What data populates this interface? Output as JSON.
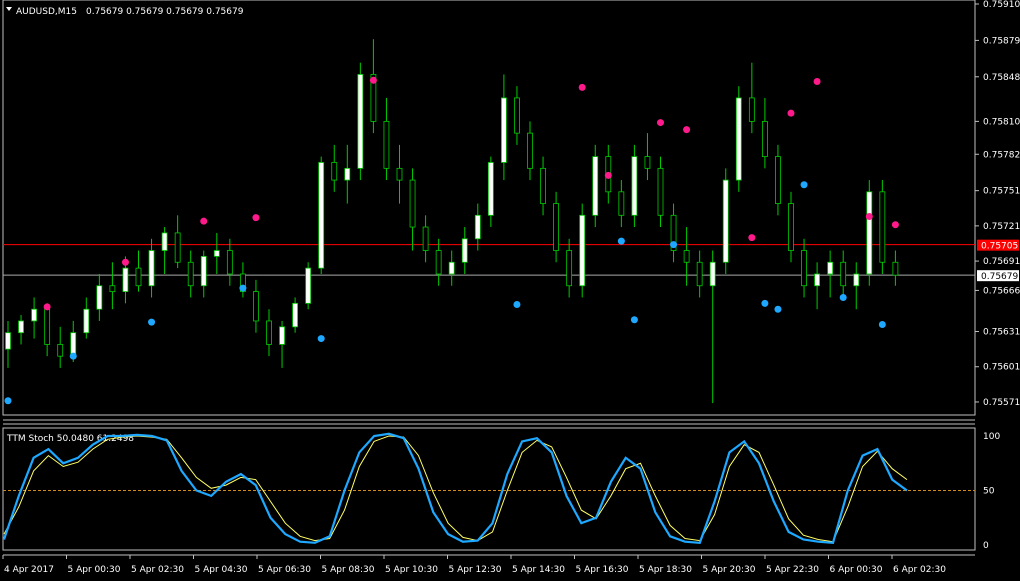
{
  "main_chart": {
    "title": "AUDUSD,M15",
    "ohlc": "0.75679 0.75679 0.75679 0.75679",
    "y_range": [
      0.75565,
      0.7591
    ],
    "price_labels": [
      "0.75910",
      "0.75879",
      "0.75848",
      "0.75810",
      "0.75782",
      "0.75751",
      "0.75721",
      "0.75691",
      "0.75666",
      "0.75631",
      "0.75601",
      "0.75571"
    ],
    "red_line": {
      "label": "0.75705",
      "value": 0.75705
    },
    "grey_line": {
      "label": "0.75679",
      "value": 0.75679
    },
    "colors": {
      "bull_fill": "#ffffff",
      "bear_fill": "#000000",
      "wick": "#00cc00",
      "red_line": "#ff0000",
      "grey_line": "#aaaaaa",
      "dot_pink": "#ff1a8c",
      "dot_blue": "#1ea8ff"
    },
    "candles": [
      [
        0.75616,
        0.7564,
        0.756,
        0.7563
      ],
      [
        0.7563,
        0.75645,
        0.7562,
        0.7564
      ],
      [
        0.7564,
        0.7566,
        0.75625,
        0.7565
      ],
      [
        0.7565,
        0.75655,
        0.7561,
        0.7562
      ],
      [
        0.7562,
        0.75635,
        0.756,
        0.7561
      ],
      [
        0.7561,
        0.7564,
        0.75605,
        0.7563
      ],
      [
        0.7563,
        0.7566,
        0.75625,
        0.7565
      ],
      [
        0.7565,
        0.7568,
        0.7564,
        0.7567
      ],
      [
        0.7567,
        0.7569,
        0.7565,
        0.75665
      ],
      [
        0.75665,
        0.75695,
        0.75655,
        0.75685
      ],
      [
        0.75685,
        0.757,
        0.75665,
        0.7567
      ],
      [
        0.7567,
        0.7571,
        0.7566,
        0.757
      ],
      [
        0.757,
        0.7572,
        0.7568,
        0.75715
      ],
      [
        0.75715,
        0.7573,
        0.75685,
        0.7569
      ],
      [
        0.7569,
        0.757,
        0.7566,
        0.7567
      ],
      [
        0.7567,
        0.757,
        0.7566,
        0.75695
      ],
      [
        0.75695,
        0.75715,
        0.7568,
        0.757
      ],
      [
        0.757,
        0.7571,
        0.7567,
        0.7568
      ],
      [
        0.7568,
        0.7569,
        0.7566,
        0.75665
      ],
      [
        0.75665,
        0.75675,
        0.7563,
        0.7564
      ],
      [
        0.7564,
        0.7565,
        0.7561,
        0.7562
      ],
      [
        0.7562,
        0.7564,
        0.756,
        0.75635
      ],
      [
        0.75635,
        0.7566,
        0.7563,
        0.75655
      ],
      [
        0.75655,
        0.7569,
        0.7565,
        0.75685
      ],
      [
        0.75685,
        0.7578,
        0.7568,
        0.75775
      ],
      [
        0.75775,
        0.7579,
        0.7575,
        0.7576
      ],
      [
        0.7576,
        0.7579,
        0.7574,
        0.7577
      ],
      [
        0.7577,
        0.7586,
        0.7576,
        0.7585
      ],
      [
        0.7585,
        0.7588,
        0.758,
        0.7581
      ],
      [
        0.7581,
        0.7583,
        0.7576,
        0.7577
      ],
      [
        0.7577,
        0.7579,
        0.7574,
        0.7576
      ],
      [
        0.7576,
        0.7577,
        0.757,
        0.7572
      ],
      [
        0.7572,
        0.7573,
        0.7569,
        0.757
      ],
      [
        0.757,
        0.7571,
        0.7567,
        0.7568
      ],
      [
        0.7568,
        0.757,
        0.7567,
        0.7569
      ],
      [
        0.7569,
        0.7572,
        0.7568,
        0.7571
      ],
      [
        0.7571,
        0.7574,
        0.757,
        0.7573
      ],
      [
        0.7573,
        0.7578,
        0.7572,
        0.75775
      ],
      [
        0.75775,
        0.7585,
        0.7576,
        0.7583
      ],
      [
        0.7583,
        0.7584,
        0.7579,
        0.758
      ],
      [
        0.758,
        0.7581,
        0.7576,
        0.7577
      ],
      [
        0.7577,
        0.7578,
        0.7573,
        0.7574
      ],
      [
        0.7574,
        0.7575,
        0.7569,
        0.757
      ],
      [
        0.757,
        0.7571,
        0.7566,
        0.7567
      ],
      [
        0.7567,
        0.7574,
        0.7566,
        0.7573
      ],
      [
        0.7573,
        0.7579,
        0.7572,
        0.7578
      ],
      [
        0.7578,
        0.7579,
        0.7574,
        0.7575
      ],
      [
        0.7575,
        0.7576,
        0.7572,
        0.7573
      ],
      [
        0.7573,
        0.7579,
        0.7572,
        0.7578
      ],
      [
        0.7578,
        0.758,
        0.7576,
        0.7577
      ],
      [
        0.7577,
        0.7578,
        0.7572,
        0.7573
      ],
      [
        0.7573,
        0.7574,
        0.7569,
        0.757
      ],
      [
        0.757,
        0.7572,
        0.7567,
        0.7569
      ],
      [
        0.7569,
        0.757,
        0.7566,
        0.7567
      ],
      [
        0.7567,
        0.757,
        0.7557,
        0.7569
      ],
      [
        0.7569,
        0.7577,
        0.7568,
        0.7576
      ],
      [
        0.7576,
        0.7584,
        0.7575,
        0.7583
      ],
      [
        0.7583,
        0.7586,
        0.758,
        0.7581
      ],
      [
        0.7581,
        0.7583,
        0.7577,
        0.7578
      ],
      [
        0.7578,
        0.7579,
        0.7573,
        0.7574
      ],
      [
        0.7574,
        0.7575,
        0.7569,
        0.757
      ],
      [
        0.757,
        0.7571,
        0.7566,
        0.7567
      ],
      [
        0.7567,
        0.7569,
        0.7565,
        0.7568
      ],
      [
        0.7568,
        0.757,
        0.7566,
        0.7569
      ],
      [
        0.7569,
        0.757,
        0.7566,
        0.7567
      ],
      [
        0.7567,
        0.7569,
        0.7565,
        0.7568
      ],
      [
        0.7568,
        0.7576,
        0.7567,
        0.7575
      ],
      [
        0.7575,
        0.7576,
        0.7568,
        0.7569
      ],
      [
        0.7569,
        0.757,
        0.7567,
        0.75679
      ]
    ],
    "dots": [
      {
        "i": 0,
        "v": 0.75572,
        "c": "blue"
      },
      {
        "i": 3,
        "v": 0.75652,
        "c": "pink"
      },
      {
        "i": 5,
        "v": 0.7561,
        "c": "blue"
      },
      {
        "i": 9,
        "v": 0.7569,
        "c": "pink"
      },
      {
        "i": 11,
        "v": 0.75639,
        "c": "blue"
      },
      {
        "i": 15,
        "v": 0.75725,
        "c": "pink"
      },
      {
        "i": 18,
        "v": 0.75668,
        "c": "blue"
      },
      {
        "i": 19,
        "v": 0.75728,
        "c": "pink"
      },
      {
        "i": 24,
        "v": 0.75625,
        "c": "blue"
      },
      {
        "i": 28,
        "v": 0.75845,
        "c": "pink"
      },
      {
        "i": 39,
        "v": 0.75654,
        "c": "blue"
      },
      {
        "i": 44,
        "v": 0.75839,
        "c": "pink"
      },
      {
        "i": 46,
        "v": 0.75764,
        "c": "pink"
      },
      {
        "i": 47,
        "v": 0.75708,
        "c": "blue"
      },
      {
        "i": 48,
        "v": 0.75641,
        "c": "blue"
      },
      {
        "i": 50,
        "v": 0.75809,
        "c": "pink"
      },
      {
        "i": 51,
        "v": 0.75705,
        "c": "blue"
      },
      {
        "i": 52,
        "v": 0.75803,
        "c": "pink"
      },
      {
        "i": 57,
        "v": 0.75711,
        "c": "pink"
      },
      {
        "i": 58,
        "v": 0.75655,
        "c": "blue"
      },
      {
        "i": 59,
        "v": 0.7565,
        "c": "blue"
      },
      {
        "i": 60,
        "v": 0.75817,
        "c": "pink"
      },
      {
        "i": 61,
        "v": 0.75756,
        "c": "blue"
      },
      {
        "i": 62,
        "v": 0.75844,
        "c": "pink"
      },
      {
        "i": 64,
        "v": 0.7566,
        "c": "blue"
      },
      {
        "i": 66,
        "v": 0.75729,
        "c": "pink"
      },
      {
        "i": 67,
        "v": 0.75637,
        "c": "blue"
      },
      {
        "i": 68,
        "v": 0.75722,
        "c": "pink"
      }
    ]
  },
  "stoch_panel": {
    "title": "TTM Stoch 50.0480 61.2498",
    "levels": [
      "100",
      "50",
      "0"
    ],
    "level_line": 50,
    "colors": {
      "fast": "#1ea8ff",
      "slow": "#ffff66",
      "level": "#d08a1a"
    },
    "fast": [
      5,
      45,
      80,
      88,
      75,
      80,
      92,
      100,
      100,
      101,
      100,
      96,
      68,
      50,
      45,
      58,
      65,
      55,
      25,
      10,
      3,
      2,
      8,
      50,
      85,
      100,
      102,
      98,
      70,
      30,
      10,
      3,
      4,
      20,
      65,
      95,
      98,
      85,
      45,
      20,
      25,
      58,
      80,
      70,
      30,
      8,
      3,
      2,
      40,
      85,
      95,
      75,
      40,
      12,
      5,
      3,
      2,
      50,
      82,
      88,
      60,
      50
    ],
    "slow": [
      10,
      35,
      68,
      82,
      72,
      76,
      88,
      97,
      99,
      100,
      99,
      97,
      80,
      62,
      52,
      55,
      62,
      60,
      40,
      20,
      8,
      4,
      6,
      32,
      72,
      95,
      100,
      99,
      82,
      48,
      20,
      7,
      4,
      12,
      50,
      85,
      96,
      90,
      62,
      32,
      24,
      45,
      70,
      75,
      45,
      18,
      6,
      4,
      28,
      72,
      92,
      85,
      55,
      24,
      9,
      5,
      3,
      35,
      72,
      86,
      70,
      60
    ]
  },
  "time_axis": [
    "4 Apr 2017",
    "5 Apr 00:30",
    "5 Apr 02:30",
    "5 Apr 04:30",
    "5 Apr 06:30",
    "5 Apr 08:30",
    "5 Apr 10:30",
    "5 Apr 12:30",
    "5 Apr 14:30",
    "5 Apr 16:30",
    "5 Apr 18:30",
    "5 Apr 20:30",
    "5 Apr 22:30",
    "6 Apr 00:30",
    "6 Apr 02:30"
  ]
}
